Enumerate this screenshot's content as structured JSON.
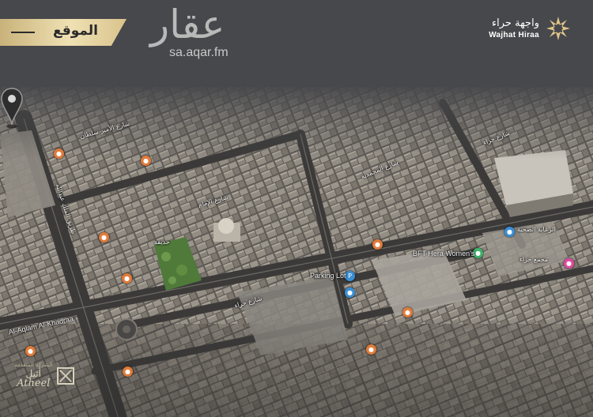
{
  "header": {
    "location_label": "الموقع",
    "aqar_logo": "عقار",
    "aqar_url": "sa.aqar.fm",
    "brand_ar": "واجهة حراء",
    "brand_en": "Wajhat Hiraa"
  },
  "map": {
    "labels": {
      "parking": "Parking Lot",
      "bft": "BFT Hera Women's",
      "alaqlam": "Al-Aqlam Al-Khadraa",
      "street_top_right": "شارع حراء",
      "street_mid": "شارع المحمدية",
      "street_bottom": "شارع حراء",
      "street_left": "طريق الملك عبدالله",
      "park_label": "حديقة",
      "poi_right_top": "الرعاية الصحية",
      "poi_right_pink": "مجمع حراء",
      "street_north": "شارع الأمير سلطان",
      "street_center": "شارع الإمام"
    },
    "pin_icon": "location-pin-icon",
    "colors": {
      "poi_orange": "#e07b3a",
      "poi_blue": "#3a8fd6",
      "poi_green": "#3bb36a",
      "poi_pink": "#e04aa0",
      "accent_gold": "#d9c38c"
    }
  },
  "footer": {
    "atheel_small": "الشركة المتقدمة",
    "atheel_ar": "أثيل",
    "atheel_en": "Atheel"
  }
}
